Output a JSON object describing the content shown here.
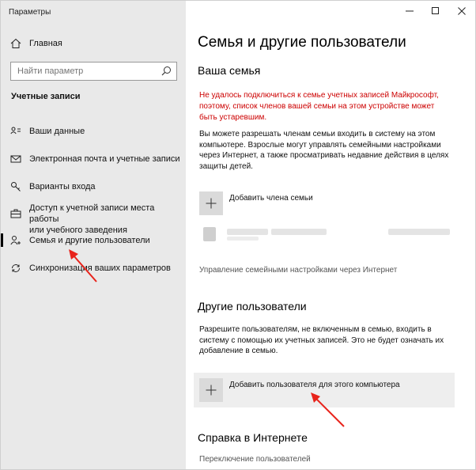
{
  "window": {
    "title": "Параметры",
    "controls": {
      "minimize": "—",
      "maximize": "☐",
      "close": "✕"
    }
  },
  "sidebar": {
    "home_label": "Главная",
    "search_placeholder": "Найти параметр",
    "section_title": "Учетные записи",
    "items": [
      {
        "label": "Ваши данные",
        "icon": "person-card-icon"
      },
      {
        "label": "Электронная почта и учетные записи",
        "icon": "mail-icon"
      },
      {
        "label": "Варианты входа",
        "icon": "key-icon"
      },
      {
        "label": "Доступ к учетной записи места работы\nили учебного заведения",
        "icon": "briefcase-icon"
      },
      {
        "label": "Семья и другие пользователи",
        "icon": "person-add-icon",
        "selected": true
      },
      {
        "label": "Синхронизация ваших параметров",
        "icon": "sync-icon"
      }
    ]
  },
  "main": {
    "page_title": "Семья и другие пользователи",
    "family": {
      "heading": "Ваша семья",
      "error": "Не удалось подключиться к семье учетных записей Майкрософт, поэтому, список членов вашей семьи на этом устройстве может быть устаревшим.",
      "description": "Вы можете разрешать членам семьи входить в систему на этом компьютере. Взрослые могут управлять семейными настройками через Интернет, а также просматривать недавние действия в целях защиты детей.",
      "add_member_label": "Добавить члена семьи",
      "manage_link": "Управление семейными настройками через Интернет"
    },
    "others": {
      "heading": "Другие пользователи",
      "description": "Разрешите пользователям, не включенным в семью, входить в систему с помощью их учетных записей. Это не будет означать их добавление в семью.",
      "add_user_label": "Добавить пользователя для этого компьютера"
    },
    "help": {
      "heading": "Справка в Интернете",
      "link": "Переключение пользователей"
    }
  },
  "colors": {
    "sidebar_bg": "#e9e9e9",
    "error_text": "#cc0000",
    "arrow": "#e8231b",
    "plus_box": "#dadada"
  }
}
